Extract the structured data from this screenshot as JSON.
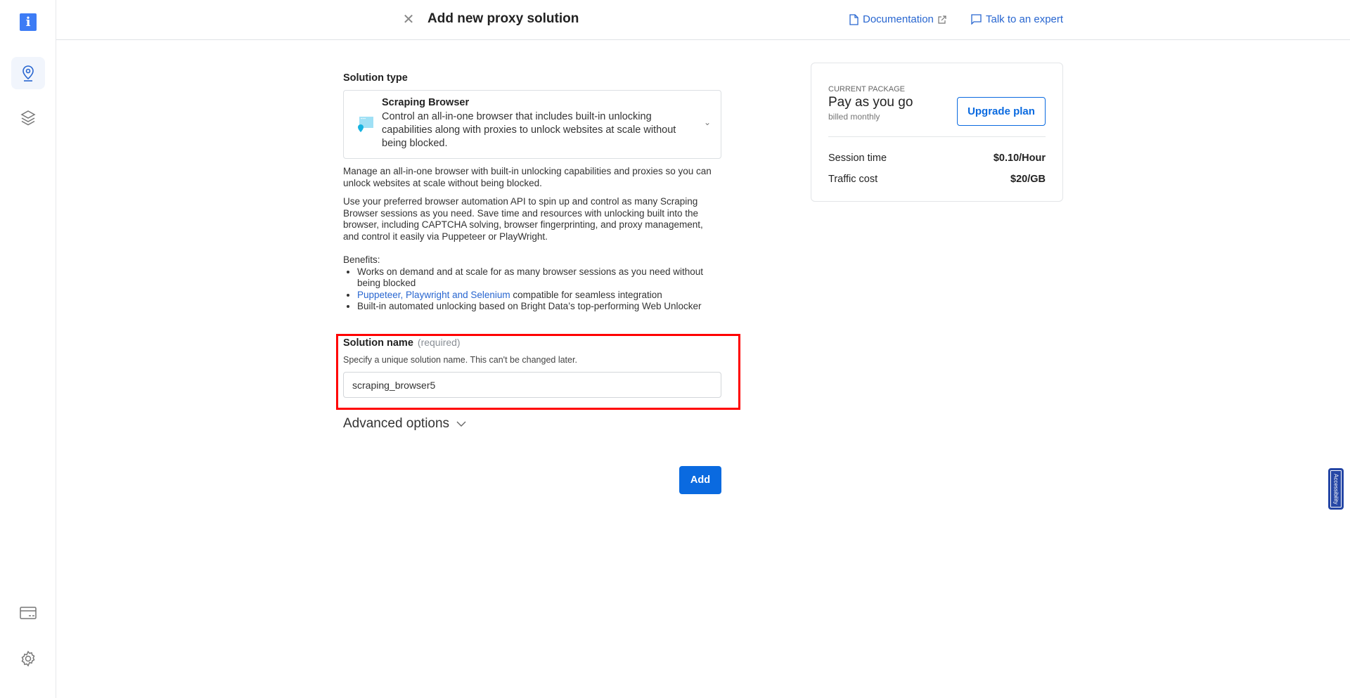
{
  "sidebar": {
    "logo": "i",
    "items": [
      {
        "icon": "location-pin-icon",
        "active": true
      },
      {
        "icon": "layers-icon"
      },
      {
        "icon": "billing-card-icon"
      },
      {
        "icon": "gear-icon"
      }
    ]
  },
  "header": {
    "title": "Add new proxy solution",
    "documentation": "Documentation",
    "talk": "Talk to an expert"
  },
  "solution_type": {
    "label": "Solution type",
    "selected_title": "Scraping Browser",
    "selected_desc": "Control an all-in-one browser that includes built-in unlocking capabilities along with proxies to unlock websites at scale without being blocked."
  },
  "description": {
    "p1": "Manage an all-in-one browser with built-in unlocking capabilities and proxies so you can unlock websites at scale without being blocked.",
    "p2": "Use your preferred browser automation API to spin up and control as many Scraping Browser sessions as you need. Save time and resources with unlocking built into the browser, including CAPTCHA solving, browser fingerprinting, and proxy management, and control it easily via Puppeteer or PlayWright.",
    "benefits_label": "Benefits:",
    "b1": "Works on demand and at scale for as many browser sessions as you need without being blocked",
    "b2_link": "Puppeteer, Playwright and Selenium",
    "b2_rest": " compatible for seamless integration",
    "b3": "Built-in automated unlocking based on Bright Data’s top-performing Web Unlocker"
  },
  "solution_name": {
    "label": "Solution name",
    "required": "(required)",
    "hint": "Specify a unique solution name. This can't be changed later.",
    "value": "scraping_browser5"
  },
  "advanced": "Advanced options",
  "add": "Add",
  "package": {
    "label": "CURRENT PACKAGE",
    "name": "Pay as you go",
    "billing": "billed monthly",
    "upgrade": "Upgrade plan",
    "rows": [
      {
        "k": "Session time",
        "v": "$0.10/Hour"
      },
      {
        "k": "Traffic cost",
        "v": "$20/GB"
      }
    ]
  },
  "accessibility": "Accessibility",
  "colors": {
    "accent": "#0a6ae0",
    "highlight": "#ff0000"
  }
}
